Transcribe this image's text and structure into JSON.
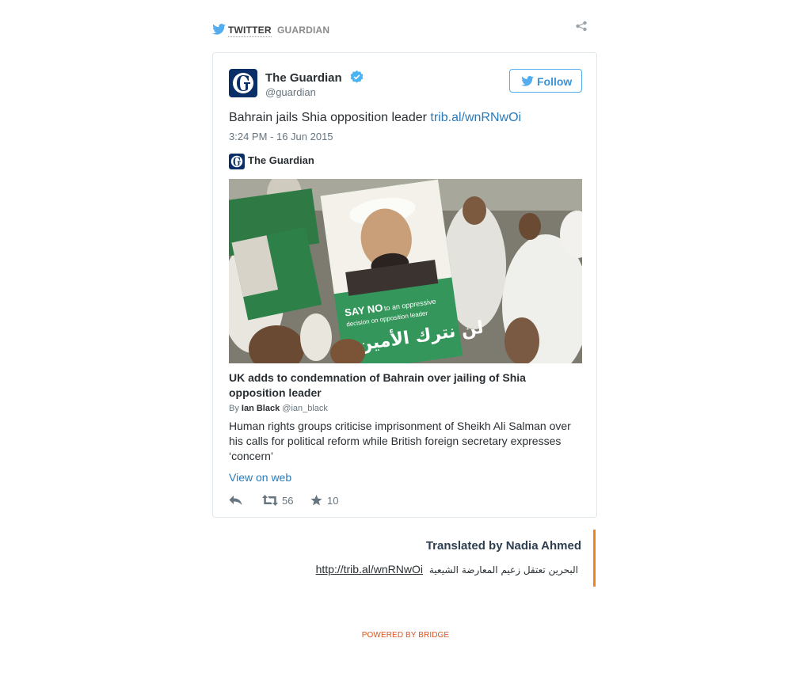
{
  "header": {
    "source_twitter": "TWITTER",
    "source_guardian": "GUARDIAN",
    "share_icon": "share-icon"
  },
  "tweet": {
    "author_name": "The Guardian",
    "author_handle": "@guardian",
    "follow_label": "Follow",
    "text": "Bahrain jails Shia opposition leader",
    "link_text": "trib.al/wnRNwOi",
    "timestamp": "3:24 PM - 16 Jun 2015",
    "card": {
      "publisher": "The Guardian",
      "photo_sign_text_1": "SAY NO",
      "photo_sign_text_2": "to an oppressive",
      "photo_sign_text_3": "decision on opposition leader",
      "photo_sign_arabic_1": "لن نترك الأمين",
      "title": "UK adds to condemnation of Bahrain over jailing of Shia opposition leader",
      "by_prefix": "By",
      "by_author": "Ian Black",
      "by_handle": "@ian_black",
      "description": "Human rights groups criticise imprisonment of Sheikh Ali Salman over his calls for political reform while British foreign secretary expresses ‘concern’"
    },
    "view_on_web": "View on web",
    "actions": {
      "retweet_count": "56",
      "favorite_count": "10"
    }
  },
  "translation": {
    "translator": "Translated by Nadia Ahmed",
    "link": "http://trib.al/wnRNwOi",
    "arabic_text": "البحرين تعتقل زعيم المعارضة الشيعية"
  },
  "footer": {
    "powered_by": "POWERED BY BRIDGE"
  },
  "colors": {
    "twitter_blue": "#55acee",
    "link_blue": "#2b7bb9",
    "guardian_navy": "#0a2f67",
    "accent_orange": "#f0841d",
    "powered_red": "#d9531e"
  }
}
